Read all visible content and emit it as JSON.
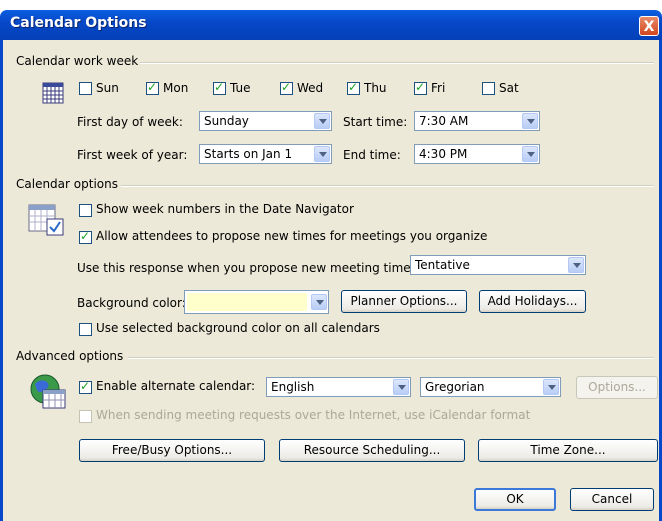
{
  "window": {
    "title": "Calendar Options",
    "close_glyph": "X"
  },
  "work_week": {
    "section_label": "Calendar work week",
    "days": [
      {
        "label": "Sun",
        "checked": false
      },
      {
        "label": "Mon",
        "checked": true
      },
      {
        "label": "Tue",
        "checked": true
      },
      {
        "label": "Wed",
        "checked": true
      },
      {
        "label": "Thu",
        "checked": true
      },
      {
        "label": "Fri",
        "checked": true
      },
      {
        "label": "Sat",
        "checked": false
      }
    ],
    "first_day_label": "First day of week:",
    "first_day_value": "Sunday",
    "first_week_label": "First week of year:",
    "first_week_value": "Starts on Jan 1",
    "start_time_label": "Start time:",
    "start_time_value": "7:30 AM",
    "end_time_label": "End time:",
    "end_time_value": "4:30 PM"
  },
  "calendar_options": {
    "section_label": "Calendar options",
    "show_week_numbers": {
      "label": "Show week numbers in the Date Navigator",
      "checked": false
    },
    "allow_propose": {
      "label": "Allow attendees to propose new times for meetings you organize",
      "checked": true
    },
    "response_label": "Use this response when you propose new meeting times:",
    "response_value": "Tentative",
    "bg_color_label": "Background color:",
    "bg_color_value": "#ffffcc",
    "planner_options_label": "Planner Options...",
    "add_holidays_label": "Add Holidays...",
    "use_bg_all": {
      "label": "Use selected background color on all calendars",
      "checked": false
    }
  },
  "advanced": {
    "section_label": "Advanced options",
    "alt_calendar": {
      "label": "Enable alternate calendar:",
      "checked": true
    },
    "language_value": "English",
    "calendar_value": "Gregorian",
    "options_label": "Options...",
    "icalendar": {
      "label": "When sending meeting requests over the Internet, use iCalendar format",
      "checked": false
    },
    "free_busy_label": "Free/Busy Options...",
    "resource_label": "Resource Scheduling...",
    "time_zone_label": "Time Zone..."
  },
  "footer": {
    "ok_label": "OK",
    "cancel_label": "Cancel"
  },
  "icons": {
    "work_week": "calendar-grid-icon",
    "calendar_options": "calendar-check-icon",
    "advanced": "globe-calendar-icon"
  },
  "colors": {
    "title_bar": "#0648c8",
    "dialog_bg": "#ece9d8",
    "check": "#21a121"
  }
}
